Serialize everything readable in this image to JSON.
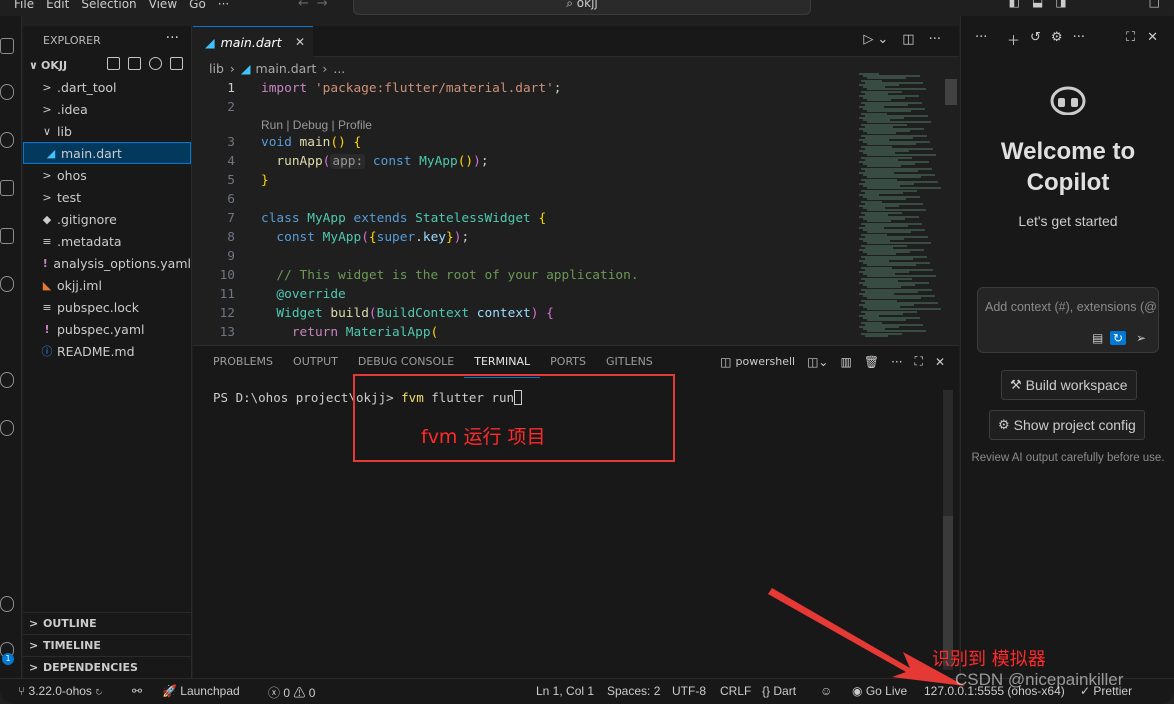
{
  "menu": [
    "File",
    "Edit",
    "Selection",
    "View",
    "Go",
    "···"
  ],
  "command_center": "okjj",
  "explorer": {
    "title": "EXPLORER",
    "project": "OKJJ",
    "items": [
      {
        "label": ".dart_tool",
        "icon": "chevron-right-icon",
        "glyph": ">",
        "indent": 1
      },
      {
        "label": ".idea",
        "icon": "chevron-right-icon",
        "glyph": ">",
        "indent": 1
      },
      {
        "label": "lib",
        "icon": "chevron-down-icon",
        "glyph": "∨",
        "indent": 1
      },
      {
        "label": "main.dart",
        "icon": "dart-file-icon",
        "glyph": "◢",
        "indent": 2,
        "selected": true
      },
      {
        "label": "ohos",
        "icon": "chevron-right-icon",
        "glyph": ">",
        "indent": 1
      },
      {
        "label": "test",
        "icon": "chevron-right-icon",
        "glyph": ">",
        "indent": 1
      },
      {
        "label": ".gitignore",
        "icon": "git-file-icon",
        "glyph": "◆",
        "indent": 1
      },
      {
        "label": ".metadata",
        "icon": "text-file-icon",
        "glyph": "≡",
        "indent": 1
      },
      {
        "label": "analysis_options.yaml",
        "icon": "yaml-file-icon",
        "glyph": "!",
        "indent": 1
      },
      {
        "label": "okjj.iml",
        "icon": "xml-file-icon",
        "glyph": "◣",
        "indent": 1
      },
      {
        "label": "pubspec.lock",
        "icon": "text-file-icon",
        "glyph": "≡",
        "indent": 1
      },
      {
        "label": "pubspec.yaml",
        "icon": "yaml-file-icon",
        "glyph": "!",
        "indent": 1
      },
      {
        "label": "README.md",
        "icon": "info-file-icon",
        "glyph": "ⓘ",
        "indent": 1
      }
    ],
    "sections": [
      "OUTLINE",
      "TIMELINE",
      "DEPENDENCIES"
    ]
  },
  "editor": {
    "tab": "main.dart",
    "breadcrumb": [
      "lib",
      "main.dart",
      "..."
    ],
    "codelens": "Run | Debug | Profile"
  },
  "panel": {
    "tabs": [
      "PROBLEMS",
      "OUTPUT",
      "DEBUG CONSOLE",
      "TERMINAL",
      "PORTS",
      "GITLENS"
    ],
    "active_tab": "TERMINAL",
    "shell": "powershell",
    "prompt": "PS D:\\ohos project\\okjj> ",
    "command": "fvm",
    "command_args": " flutter run",
    "annotation": "fvm 运行 项目"
  },
  "copilot": {
    "title": "Welcome to Copilot",
    "subtitle": "Let's get started",
    "input_placeholder": "Add context (#), extensions (@",
    "build_button": "Build workspace",
    "config_button": "Show project config",
    "note": "Review AI output carefully before use."
  },
  "statusbar": {
    "version": "3.22.0-ohos",
    "launchpad": "Launchpad",
    "errors": "0",
    "warnings": "0",
    "position": "Ln 1, Col 1",
    "spaces": "Spaces: 2",
    "encoding": "UTF-8",
    "eol": "CRLF",
    "language": "Dart",
    "golive": "Go Live",
    "device": "127.0.0.1:5555 (ohos-x64)",
    "prettier": "Prettier"
  },
  "annotation_label": "识别到 模拟器",
  "watermark": "CSDN @nicepainkiller",
  "colors": {
    "accent": "#0078d4",
    "annotation": "#e53935"
  }
}
